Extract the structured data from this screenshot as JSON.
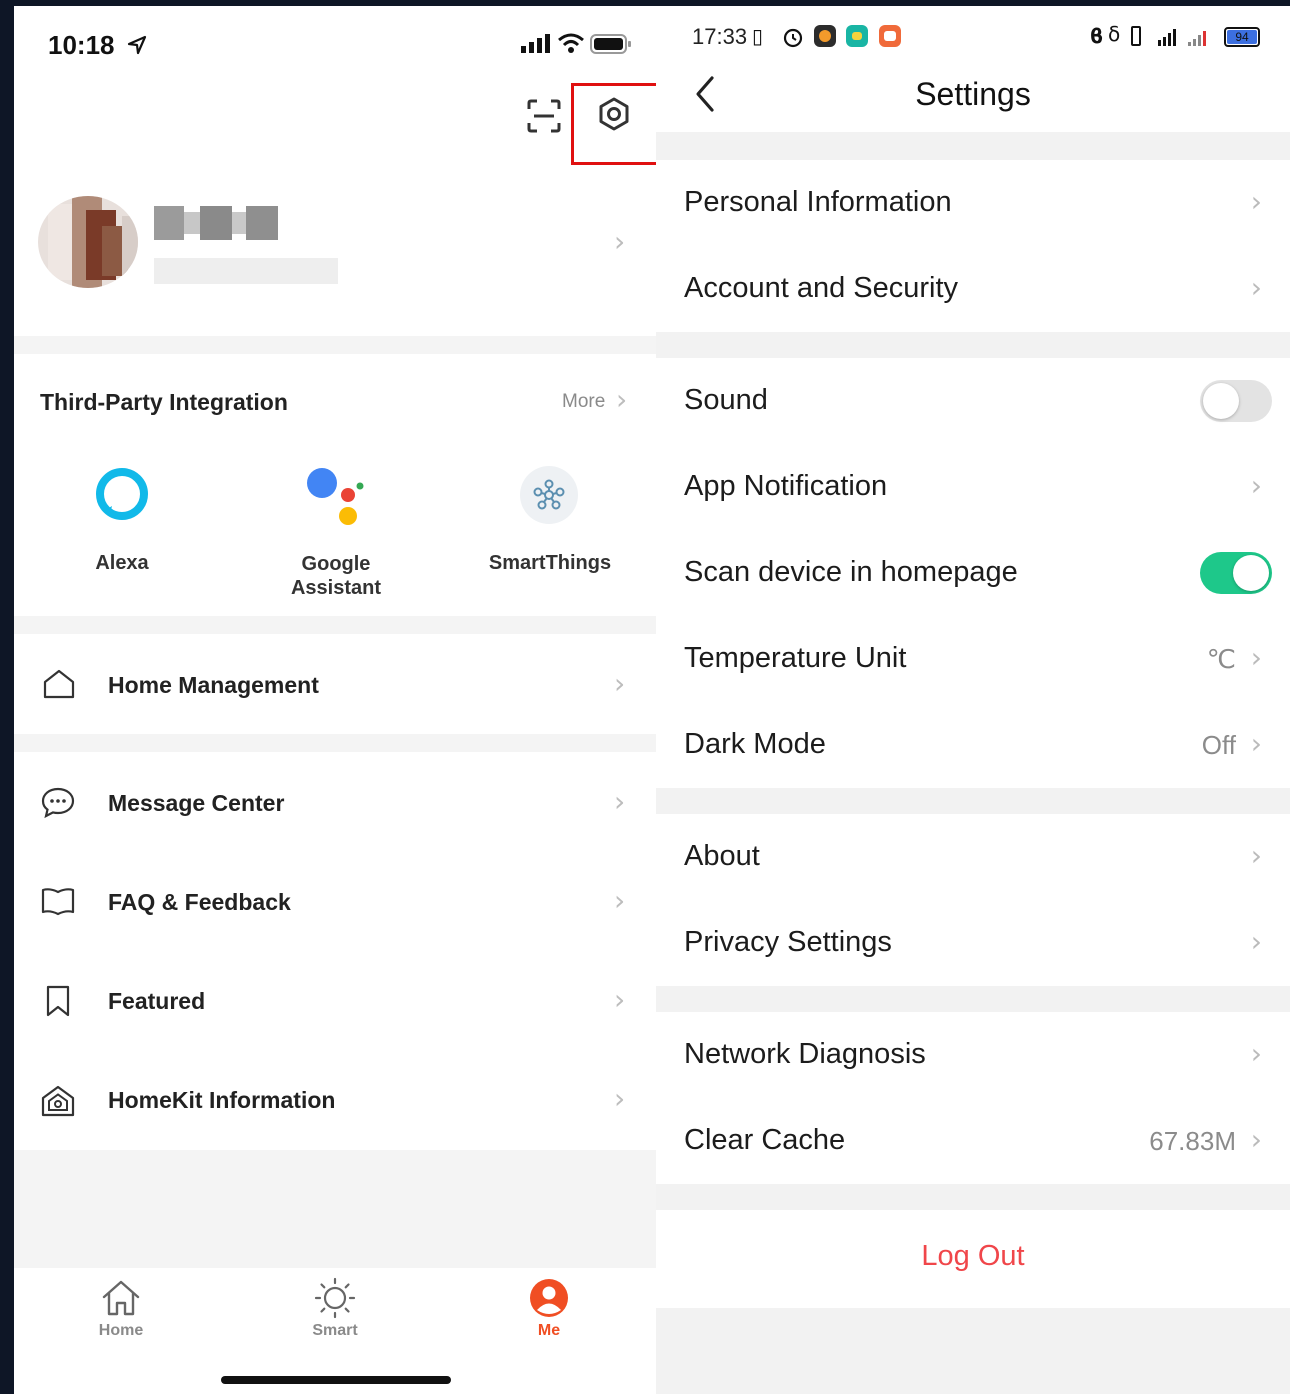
{
  "left": {
    "status_time": "10:18",
    "third_party": {
      "title": "Third-Party Integration",
      "more": "More",
      "items": [
        {
          "label_line1": "Alexa",
          "label_line2": ""
        },
        {
          "label_line1": "Google",
          "label_line2": "Assistant"
        },
        {
          "label_line1": "SmartThings",
          "label_line2": ""
        }
      ]
    },
    "menu": {
      "home_management": "Home Management",
      "message_center": "Message Center",
      "faq_feedback": "FAQ & Feedback",
      "featured": "Featured",
      "homekit": "HomeKit Information"
    },
    "tabbar": {
      "home": "Home",
      "smart": "Smart",
      "me": "Me"
    },
    "colors": {
      "accent": "#f04e23",
      "highlight_box": "#e01010"
    }
  },
  "right": {
    "status_time": "17:33",
    "battery": "94",
    "title": "Settings",
    "rows": {
      "personal_info": "Personal Information",
      "account_security": "Account and Security",
      "sound": "Sound",
      "app_notification": "App Notification",
      "scan_device": "Scan device in homepage",
      "temperature_unit": "Temperature Unit",
      "temperature_value": "℃",
      "dark_mode": "Dark Mode",
      "dark_mode_value": "Off",
      "about": "About",
      "privacy": "Privacy Settings",
      "network_diag": "Network Diagnosis",
      "clear_cache": "Clear Cache",
      "cache_value": "67.83M"
    },
    "toggles": {
      "sound": false,
      "scan_device": true
    },
    "logout": "Log Out",
    "colors": {
      "toggle_on": "#1ec88a",
      "toggle_off": "#e3e3e3",
      "logout": "#f0464a"
    }
  }
}
